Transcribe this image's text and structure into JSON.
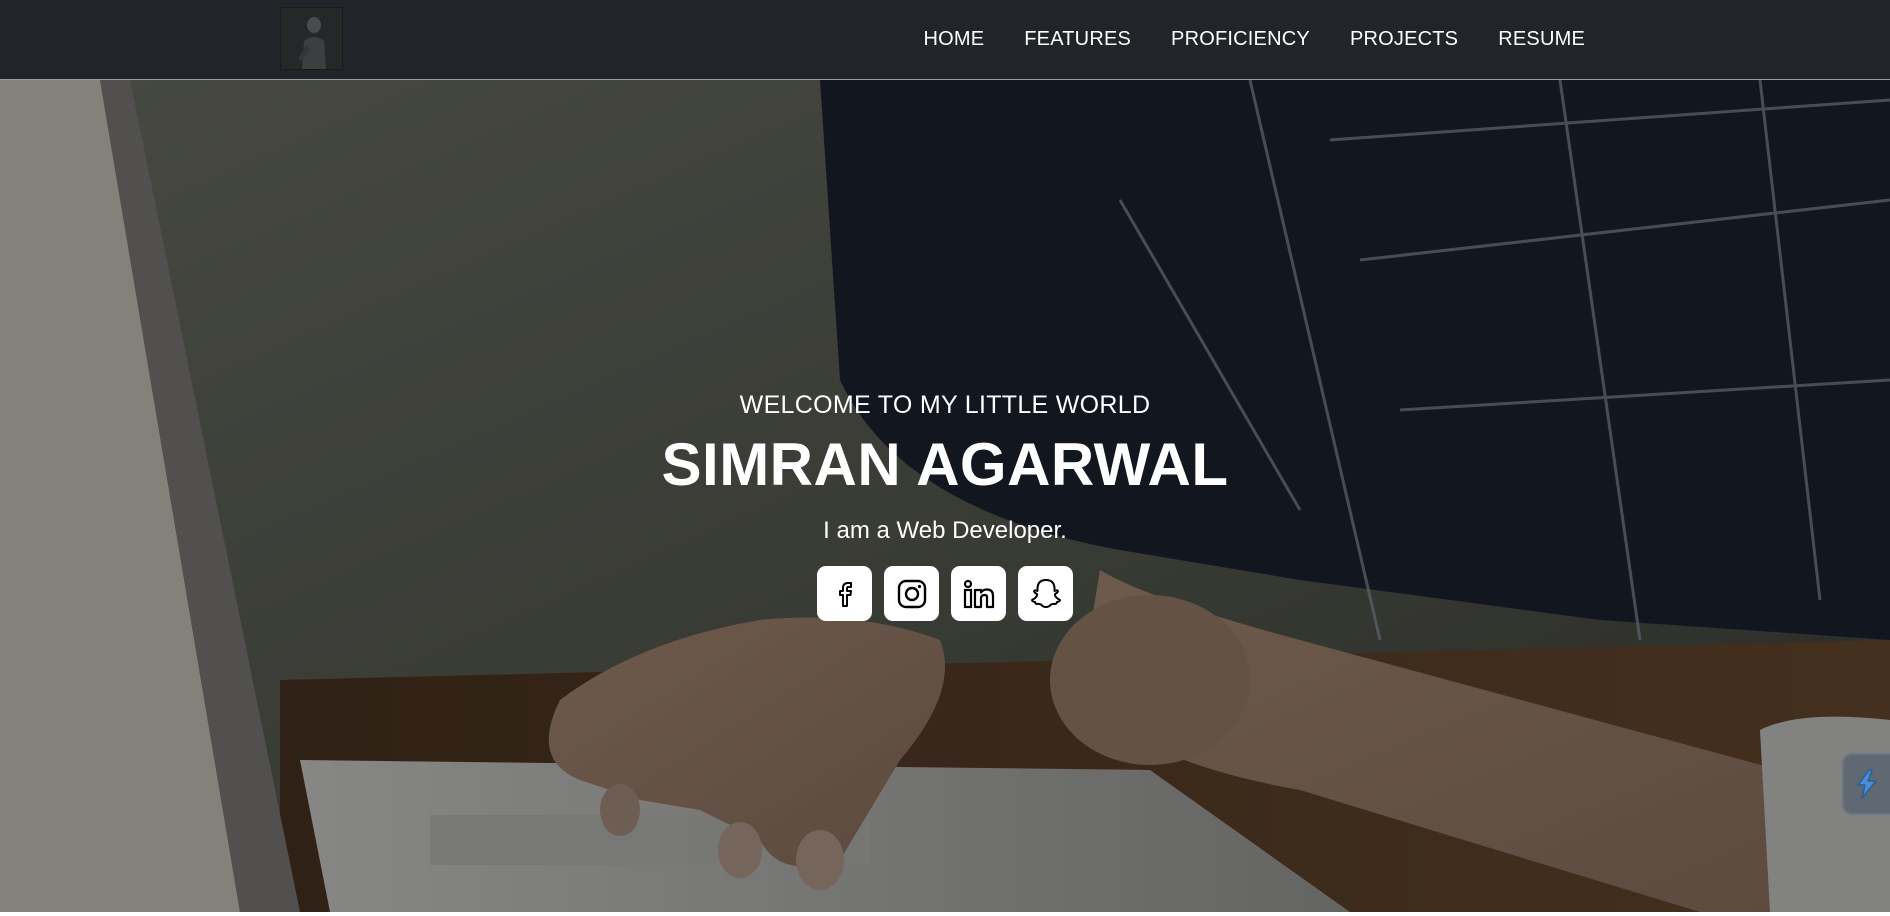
{
  "nav": {
    "logo_icon": "profile-photo",
    "links": [
      "HOME",
      "FEATURES",
      "PROFICIENCY",
      "PROJECTS",
      "RESUME"
    ]
  },
  "hero": {
    "welcome": "WELCOME TO MY LITTLE WORLD",
    "name": "SIMRAN AGARWAL",
    "tagline": "I am a Web Developer.",
    "background": "person-typing-on-laptop-photo",
    "socials": [
      {
        "icon": "facebook-icon"
      },
      {
        "icon": "instagram-icon"
      },
      {
        "icon": "linkedin-icon"
      },
      {
        "icon": "snapchat-icon"
      }
    ]
  },
  "colors": {
    "navbar_bg": "#212429",
    "text": "#ffffff",
    "social_bg": "#ffffff",
    "social_icon": "#000000"
  }
}
